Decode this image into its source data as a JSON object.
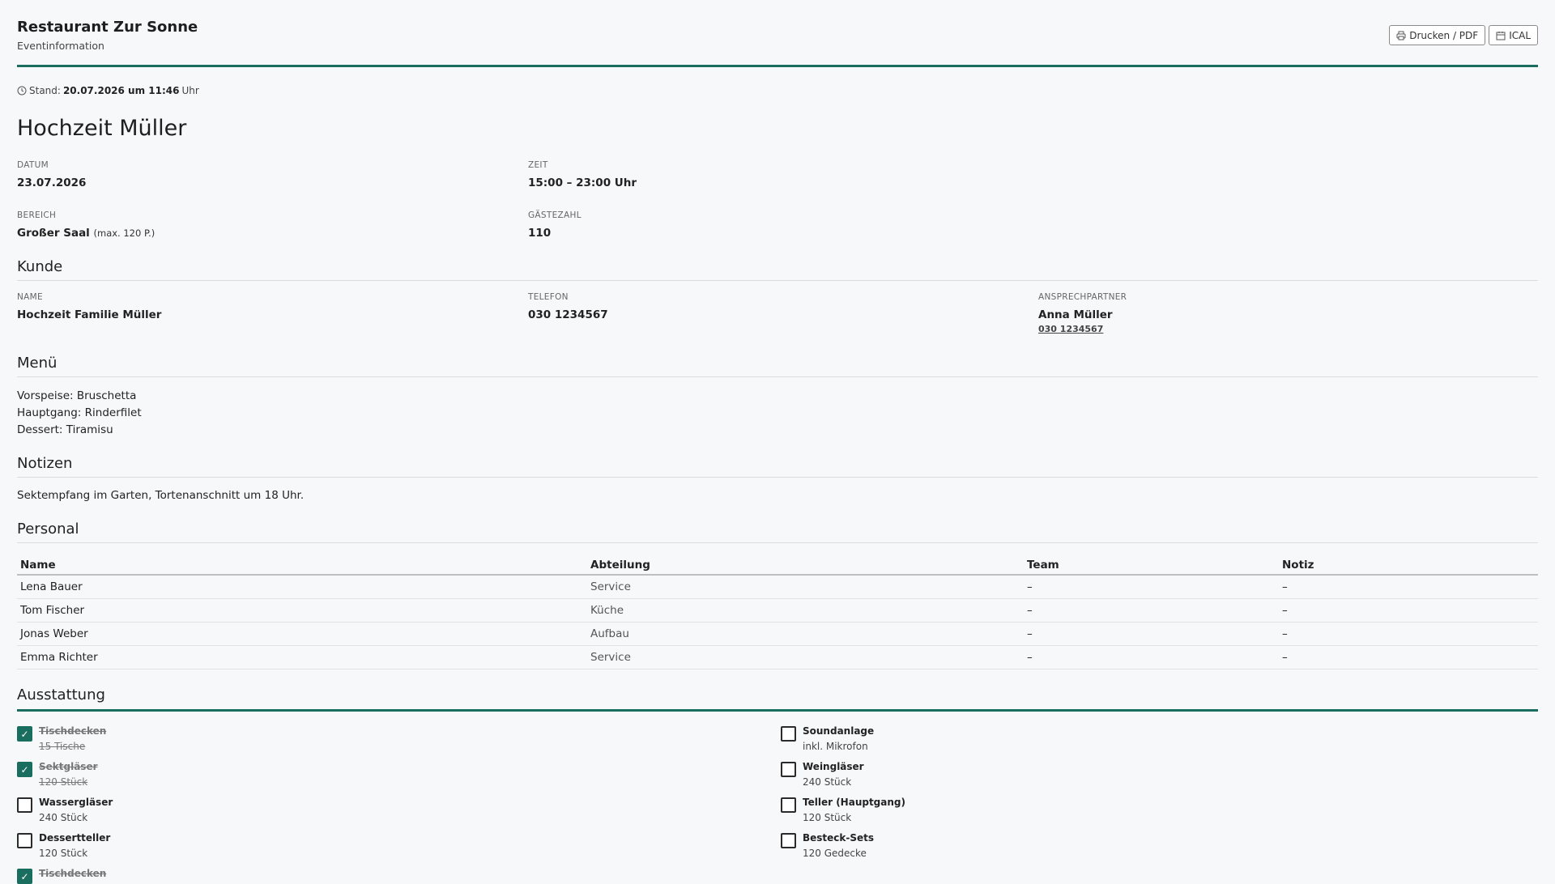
{
  "brand": {
    "title": "Restaurant Zur Sonne",
    "subtitle": "Eventinformation"
  },
  "actions": {
    "print_label": "Drucken / PDF",
    "ical_label": "ICAL"
  },
  "stand": {
    "label": "Stand:",
    "datetime": "20.07.2026 um 11:46",
    "suffix": "Uhr"
  },
  "event": {
    "title": "Hochzeit Müller",
    "datum_label": "DATUM",
    "datum": "23.07.2026",
    "zeit_label": "ZEIT",
    "zeit": "15:00 – 23:00 Uhr",
    "bereich_label": "BEREICH",
    "bereich": "Großer Saal",
    "bereich_cap": "(max. 120 P.)",
    "gaeste_label": "GÄSTEZAHL",
    "gaeste": "110"
  },
  "kunde": {
    "heading": "Kunde",
    "name_label": "NAME",
    "name": "Hochzeit Familie Müller",
    "telefon_label": "TELEFON",
    "telefon": "030 1234567",
    "ansprech_label": "ANSPRECHPARTNER",
    "ansprech_name": "Anna Müller",
    "ansprech_tel": "030 1234567"
  },
  "menu": {
    "heading": "Menü",
    "lines": [
      "Vorspeise: Bruschetta",
      "Hauptgang: Rinderfilet",
      "Dessert: Tiramisu"
    ]
  },
  "notizen": {
    "heading": "Notizen",
    "text": "Sektempfang im Garten, Tortenanschnitt um 18 Uhr."
  },
  "personal": {
    "heading": "Personal",
    "columns": [
      "Name",
      "Abteilung",
      "Team",
      "Notiz"
    ],
    "rows": [
      [
        "Lena Bauer",
        "Service",
        "–",
        "–"
      ],
      [
        "Tom Fischer",
        "Küche",
        "–",
        "–"
      ],
      [
        "Jonas Weber",
        "Aufbau",
        "–",
        "–"
      ],
      [
        "Emma Richter",
        "Service",
        "–",
        "–"
      ]
    ]
  },
  "ausstattung": {
    "heading": "Ausstattung",
    "left": [
      {
        "name": "Tischdecken",
        "sub": "15 Tische",
        "checked": true
      },
      {
        "name": "Sektgläser",
        "sub": "120 Stück",
        "checked": true
      },
      {
        "name": "Wassergläser",
        "sub": "240 Stück",
        "checked": false
      },
      {
        "name": "Dessertteller",
        "sub": "120 Stück",
        "checked": false
      },
      {
        "name": "Tischdecken",
        "sub": "",
        "checked": true
      }
    ],
    "right": [
      {
        "name": "Soundanlage",
        "sub": "inkl. Mikrofon",
        "checked": false
      },
      {
        "name": "Weingläser",
        "sub": "240 Stück",
        "checked": false
      },
      {
        "name": "Teller (Hauptgang)",
        "sub": "120 Stück",
        "checked": false
      },
      {
        "name": "Besteck-Sets",
        "sub": "120 Gedecke",
        "checked": false
      }
    ]
  },
  "colors": {
    "accent": "#1a6e5f"
  }
}
